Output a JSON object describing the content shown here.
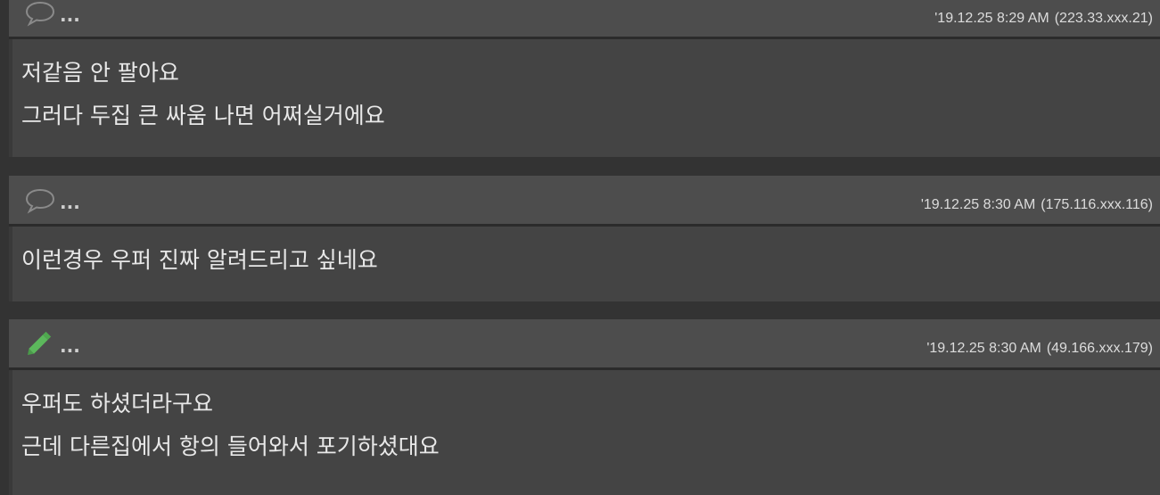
{
  "comments": [
    {
      "icon": "speech-bubble-icon",
      "more": "...",
      "date": "'19.12.25 8:29 AM",
      "ip": "(223.33.xxx.21)",
      "lines": [
        "저같음 안 팔아요",
        "그러다 두집 큰 싸움 나면 어쩌실거에요"
      ]
    },
    {
      "icon": "speech-bubble-icon",
      "more": "...",
      "date": "'19.12.25 8:30 AM",
      "ip": "(175.116.xxx.116)",
      "lines": [
        "이런경우 우퍼 진짜 알려드리고 싶네요"
      ]
    },
    {
      "icon": "pencil-icon",
      "icon_color": "#5cb85c",
      "more": "...",
      "date": "'19.12.25 8:30 AM",
      "ip": "(49.166.xxx.179)",
      "lines": [
        "우퍼도 하셨더라구요",
        "근데 다른집에서 항의 들어와서 포기하셨대요"
      ]
    }
  ]
}
